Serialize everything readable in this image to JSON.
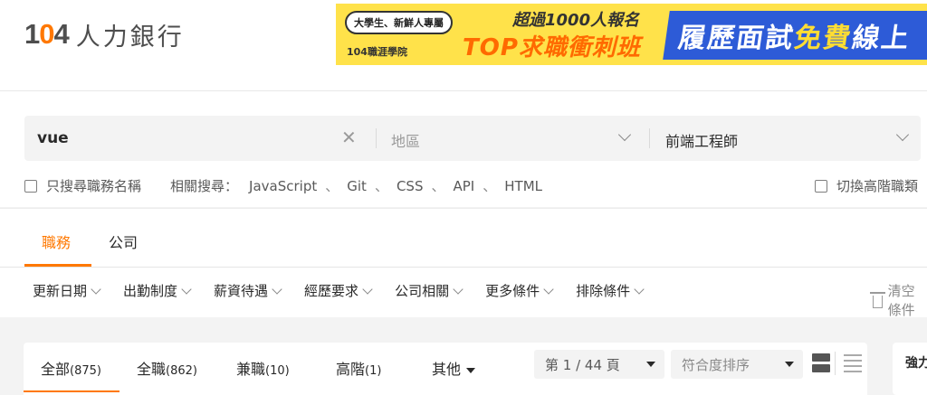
{
  "header": {
    "logo_number": "104",
    "logo_text": "人力銀行",
    "banner": {
      "tag": "大學生、新鮮人專屬",
      "org": "104職涯學院",
      "sub": "超過1000人報名",
      "main": "TOP求職衝刺班",
      "blue_a": "履歷面試",
      "blue_hl": "免費",
      "blue_b": "線上"
    }
  },
  "search": {
    "keyword": "vue",
    "area_placeholder": "地區",
    "job_category": "前端工程師",
    "only_title_label": "只搜尋職務名稱",
    "related_label": "相關搜尋：",
    "related": [
      "JavaScript",
      "Git",
      "CSS",
      "API",
      "HTML"
    ],
    "advanced_label": "切換高階職類"
  },
  "tabs": {
    "jobs": "職務",
    "company": "公司"
  },
  "filters": [
    "更新日期",
    "出勤制度",
    "薪資待遇",
    "經歷要求",
    "公司相關",
    "更多條件",
    "排除條件"
  ],
  "clear_label": "清空條件",
  "results": {
    "tabs": [
      {
        "label": "全部",
        "count": "(875)"
      },
      {
        "label": "全職",
        "count": "(862)"
      },
      {
        "label": "兼職",
        "count": "(10)"
      },
      {
        "label": "高階",
        "count": "(1)"
      }
    ],
    "other_label": "其他",
    "page_select": "第 1 / 44 頁",
    "sort_select": "符合度排序"
  },
  "side_card_title": "強力"
}
